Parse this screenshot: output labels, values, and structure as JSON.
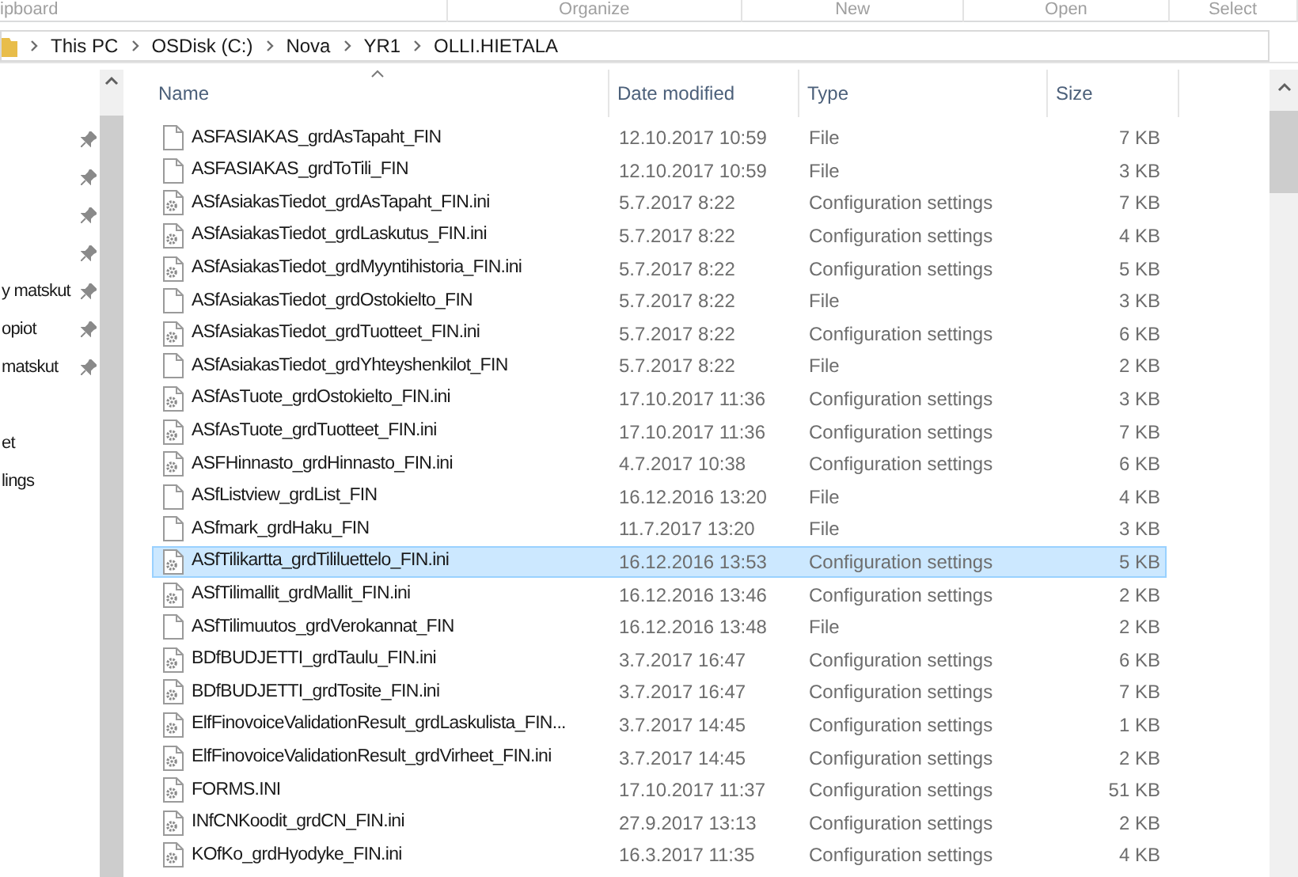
{
  "ribbon_groups": [
    "ipboard",
    "Organize",
    "New",
    "Open",
    "Select"
  ],
  "breadcrumb": [
    "This PC",
    "OSDisk (C:)",
    "Nova",
    "YR1",
    "OLLI.HIETALA"
  ],
  "nav_items": [
    {
      "pinned": true
    },
    {
      "pinned": true
    },
    {
      "pinned": true
    },
    {
      "pinned": true
    },
    {
      "label": "y matskut",
      "pinned": true
    },
    {
      "label": "opiot",
      "pinned": true
    },
    {
      "label": "matskut",
      "pinned": true
    },
    {
      "pinned": false
    },
    {
      "label": "et",
      "pinned": false
    },
    {
      "label": "lings",
      "pinned": false
    }
  ],
  "columns": [
    "Name",
    "Date modified",
    "Type",
    "Size"
  ],
  "rows": [
    {
      "name": "ASFASIAKAS_grdAsTapaht_FIN",
      "date": "12.10.2017 10:59",
      "type": "File",
      "size": "7 KB",
      "kind": "file",
      "selected": false
    },
    {
      "name": "ASFASIAKAS_grdToTili_FIN",
      "date": "12.10.2017 10:59",
      "type": "File",
      "size": "3 KB",
      "kind": "file",
      "selected": false
    },
    {
      "name": "ASfAsiakasTiedot_grdAsTapaht_FIN.ini",
      "date": "5.7.2017 8:22",
      "type": "Configuration settings",
      "size": "7 KB",
      "kind": "settings",
      "selected": false
    },
    {
      "name": "ASfAsiakasTiedot_grdLaskutus_FIN.ini",
      "date": "5.7.2017 8:22",
      "type": "Configuration settings",
      "size": "4 KB",
      "kind": "settings",
      "selected": false
    },
    {
      "name": "ASfAsiakasTiedot_grdMyyntihistoria_FIN.ini",
      "date": "5.7.2017 8:22",
      "type": "Configuration settings",
      "size": "5 KB",
      "kind": "settings",
      "selected": false
    },
    {
      "name": "ASfAsiakasTiedot_grdOstokielto_FIN",
      "date": "5.7.2017 8:22",
      "type": "File",
      "size": "3 KB",
      "kind": "file",
      "selected": false
    },
    {
      "name": "ASfAsiakasTiedot_grdTuotteet_FIN.ini",
      "date": "5.7.2017 8:22",
      "type": "Configuration settings",
      "size": "6 KB",
      "kind": "settings",
      "selected": false
    },
    {
      "name": "ASfAsiakasTiedot_grdYhteyshenkilot_FIN",
      "date": "5.7.2017 8:22",
      "type": "File",
      "size": "2 KB",
      "kind": "file",
      "selected": false
    },
    {
      "name": "ASfAsTuote_grdOstokielto_FIN.ini",
      "date": "17.10.2017 11:36",
      "type": "Configuration settings",
      "size": "3 KB",
      "kind": "settings",
      "selected": false
    },
    {
      "name": "ASfAsTuote_grdTuotteet_FIN.ini",
      "date": "17.10.2017 11:36",
      "type": "Configuration settings",
      "size": "7 KB",
      "kind": "settings",
      "selected": false
    },
    {
      "name": "ASFHinnasto_grdHinnasto_FIN.ini",
      "date": "4.7.2017 10:38",
      "type": "Configuration settings",
      "size": "6 KB",
      "kind": "settings",
      "selected": false
    },
    {
      "name": "ASfListview_grdList_FIN",
      "date": "16.12.2016 13:20",
      "type": "File",
      "size": "4 KB",
      "kind": "file",
      "selected": false
    },
    {
      "name": "ASfmark_grdHaku_FIN",
      "date": "11.7.2017 13:20",
      "type": "File",
      "size": "3 KB",
      "kind": "file",
      "selected": false
    },
    {
      "name": "ASfTilikartta_grdTililuettelo_FIN.ini",
      "date": "16.12.2016 13:53",
      "type": "Configuration settings",
      "size": "5 KB",
      "kind": "settings",
      "selected": true
    },
    {
      "name": "ASfTilimallit_grdMallit_FIN.ini",
      "date": "16.12.2016 13:46",
      "type": "Configuration settings",
      "size": "2 KB",
      "kind": "settings",
      "selected": false
    },
    {
      "name": "ASfTilimuutos_grdVerokannat_FIN",
      "date": "16.12.2016 13:48",
      "type": "File",
      "size": "2 KB",
      "kind": "file",
      "selected": false
    },
    {
      "name": "BDfBUDJETTI_grdTaulu_FIN.ini",
      "date": "3.7.2017 16:47",
      "type": "Configuration settings",
      "size": "6 KB",
      "kind": "settings",
      "selected": false
    },
    {
      "name": "BDfBUDJETTI_grdTosite_FIN.ini",
      "date": "3.7.2017 16:47",
      "type": "Configuration settings",
      "size": "7 KB",
      "kind": "settings",
      "selected": false
    },
    {
      "name": "ElfFinovoiceValidationResult_grdLaskulista_FIN...",
      "date": "3.7.2017 14:45",
      "type": "Configuration settings",
      "size": "1 KB",
      "kind": "settings",
      "selected": false
    },
    {
      "name": "ElfFinovoiceValidationResult_grdVirheet_FIN.ini",
      "date": "3.7.2017 14:45",
      "type": "Configuration settings",
      "size": "2 KB",
      "kind": "settings",
      "selected": false
    },
    {
      "name": "FORMS.INI",
      "date": "17.10.2017 11:37",
      "type": "Configuration settings",
      "size": "51 KB",
      "kind": "settings",
      "selected": false
    },
    {
      "name": "INfCNKoodit_grdCN_FIN.ini",
      "date": "27.9.2017 13:13",
      "type": "Configuration settings",
      "size": "2 KB",
      "kind": "settings",
      "selected": false
    },
    {
      "name": "KOfKo_grdHyodyke_FIN.ini",
      "date": "16.3.2017 11:35",
      "type": "Configuration settings",
      "size": "4 KB",
      "kind": "settings",
      "selected": false
    }
  ]
}
